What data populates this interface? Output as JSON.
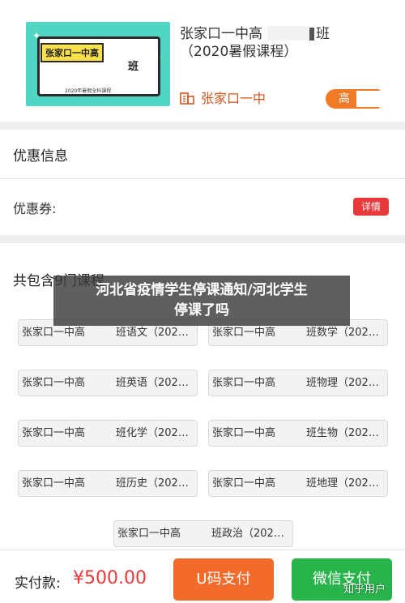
{
  "product": {
    "thumb_title": "张家口一中高",
    "thumb_ban": "班",
    "thumb_sub": "2020年暑假全科课程",
    "title_line1": "张家口一中高",
    "title_ban": "班",
    "title_line2": "（2020暑假课程）",
    "school": "张家口一中",
    "grade_tag": "高"
  },
  "discount": {
    "section_title": "优惠信息",
    "coupon_label": "优惠券:",
    "detail_button": "详情"
  },
  "courses": {
    "section_title": "共包含9门课程",
    "items": [
      {
        "left": "张家口一中高",
        "right": "班语文（202…"
      },
      {
        "left": "张家口一中高",
        "right": "班数学（202…"
      },
      {
        "left": "张家口一中高",
        "right": "班英语（202…"
      },
      {
        "left": "张家口一中高",
        "right": "班物理（202…"
      },
      {
        "left": "张家口一中高",
        "right": "班化学（202…"
      },
      {
        "left": "张家口一中高",
        "right": "班生物（202…"
      },
      {
        "left": "张家口一中高",
        "right": "班历史（202…"
      },
      {
        "left": "张家口一中高",
        "right": "班地理（202…"
      },
      {
        "left": "张家口一中高",
        "right": "班政治（202…"
      }
    ]
  },
  "overlay": {
    "line1": "河北省疫情学生停课通知/河北学生",
    "line2": "停课了吗"
  },
  "bottom_bar": {
    "pay_label": "实付款:",
    "pay_amount": "¥500.00",
    "ucode_button": "U码支付",
    "wechat_button": "微信支付"
  },
  "watermark": "知乎用户",
  "colors": {
    "accent_orange": "#f26b2a",
    "accent_green": "#28b44a",
    "price_red": "#e8393a",
    "school_orange": "#d4561e"
  }
}
